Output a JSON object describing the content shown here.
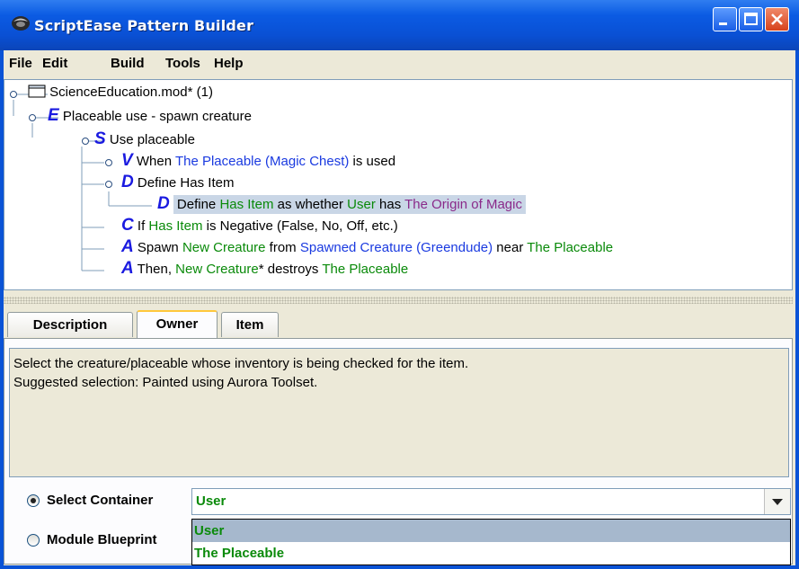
{
  "window": {
    "title": "ScriptEase Pattern Builder"
  },
  "menu": {
    "file": "File",
    "edit": "Edit",
    "build": "Build",
    "tools": "Tools",
    "help": "Help"
  },
  "tree": {
    "root": {
      "label": "ScienceEducation.mod* (1)"
    },
    "encounter": {
      "letter": "E",
      "label": "Placeable use - spawn creature"
    },
    "situation": {
      "letter": "S",
      "label": "Use placeable"
    },
    "event": {
      "letter": "V",
      "pre": "When ",
      "target": "The Placeable (Magic Chest)",
      "post": " is used"
    },
    "define_group": {
      "letter": "D",
      "label": "Define Has Item"
    },
    "define": {
      "letter": "D",
      "pre": "Define ",
      "var": "Has Item",
      "mid": " as whether ",
      "who": "User",
      "has": " has ",
      "item": "The Origin of Magic"
    },
    "condition": {
      "letter": "C",
      "pre": "If ",
      "var": "Has Item",
      "post": " is Negative (False, No, Off, etc.)"
    },
    "action1": {
      "letter": "A",
      "pre": "Spawn ",
      "new": "New Creature",
      "from": " from ",
      "spawned": "Spawned Creature (Greendude)",
      "near": " near ",
      "placeable": "The Placeable"
    },
    "action2": {
      "letter": "A",
      "pre": "Then, ",
      "new": "New Creature",
      "star": "* destroys ",
      "placeable": "The Placeable"
    }
  },
  "tabs": {
    "description": "Description",
    "owner": "Owner",
    "item": "Item"
  },
  "description": {
    "line1": "Select the creature/placeable whose inventory is being checked for the item.",
    "line2": "Suggested selection: Painted using Aurora Toolset."
  },
  "options": {
    "select_container": "Select Container",
    "module_blueprint": "Module Blueprint"
  },
  "combo": {
    "value": "User",
    "options": [
      "User",
      "The Placeable"
    ]
  },
  "colors": {
    "var": "#0a8a0a",
    "ref": "#1a3ae0",
    "item": "#8a2a8a",
    "letter": "#1a1ae0",
    "selection": "#c9d6e6"
  }
}
